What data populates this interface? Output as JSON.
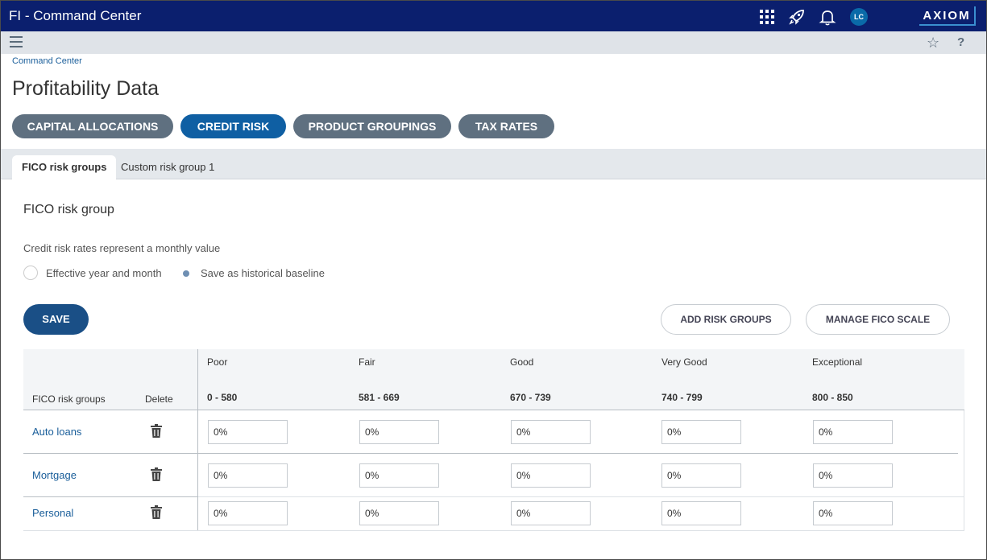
{
  "app": {
    "title": "FI - Command Center",
    "logo": "AXIOM",
    "avatar_initials": "LC"
  },
  "topbar_icons": [
    "apps-grid-icon",
    "rocket-icon",
    "bell-icon"
  ],
  "subbar": {
    "menu_icon": "hamburger-icon",
    "favorite_icon": "star-icon",
    "help_label": "?"
  },
  "breadcrumb": "Command Center",
  "page_title": "Profitability Data",
  "nav_pills": [
    {
      "label": "CAPITAL ALLOCATIONS",
      "active": false
    },
    {
      "label": "CREDIT RISK",
      "active": true
    },
    {
      "label": "PRODUCT GROUPINGS",
      "active": false
    },
    {
      "label": "TAX RATES",
      "active": false
    }
  ],
  "tabs": [
    {
      "label": "FICO risk groups",
      "active": true
    },
    {
      "label": "Custom risk group 1",
      "active": false
    }
  ],
  "section_title": "FICO risk group",
  "note": "Credit risk rates represent a monthly value",
  "radios": [
    {
      "label": "Effective year and month",
      "selected": false
    },
    {
      "label": "Save as historical baseline",
      "selected": true
    }
  ],
  "buttons": {
    "save": "SAVE",
    "add_risk_groups": "ADD RISK GROUPS",
    "manage_fico_scale": "MANAGE FICO SCALE"
  },
  "table": {
    "col_group": "FICO risk groups",
    "col_delete": "Delete",
    "columns": [
      {
        "name": "Poor",
        "range": "0 - 580"
      },
      {
        "name": "Fair",
        "range": "581 - 669"
      },
      {
        "name": "Good",
        "range": "670 - 739"
      },
      {
        "name": "Very Good",
        "range": "740 - 799"
      },
      {
        "name": "Exceptional",
        "range": "800 - 850"
      }
    ],
    "rows": [
      {
        "name": "Auto loans",
        "values": [
          "0%",
          "0%",
          "0%",
          "0%",
          "0%"
        ]
      },
      {
        "name": "Mortgage",
        "values": [
          "0%",
          "0%",
          "0%",
          "0%",
          "0%"
        ]
      },
      {
        "name": "Personal",
        "values": [
          "0%",
          "0%",
          "0%",
          "0%",
          "0%"
        ]
      }
    ]
  },
  "colors": {
    "topbar": "#0b1f6e",
    "active_pill": "#0f5fa3",
    "pill": "#5f7080",
    "save": "#1a4f86",
    "link": "#1a5e9a"
  }
}
